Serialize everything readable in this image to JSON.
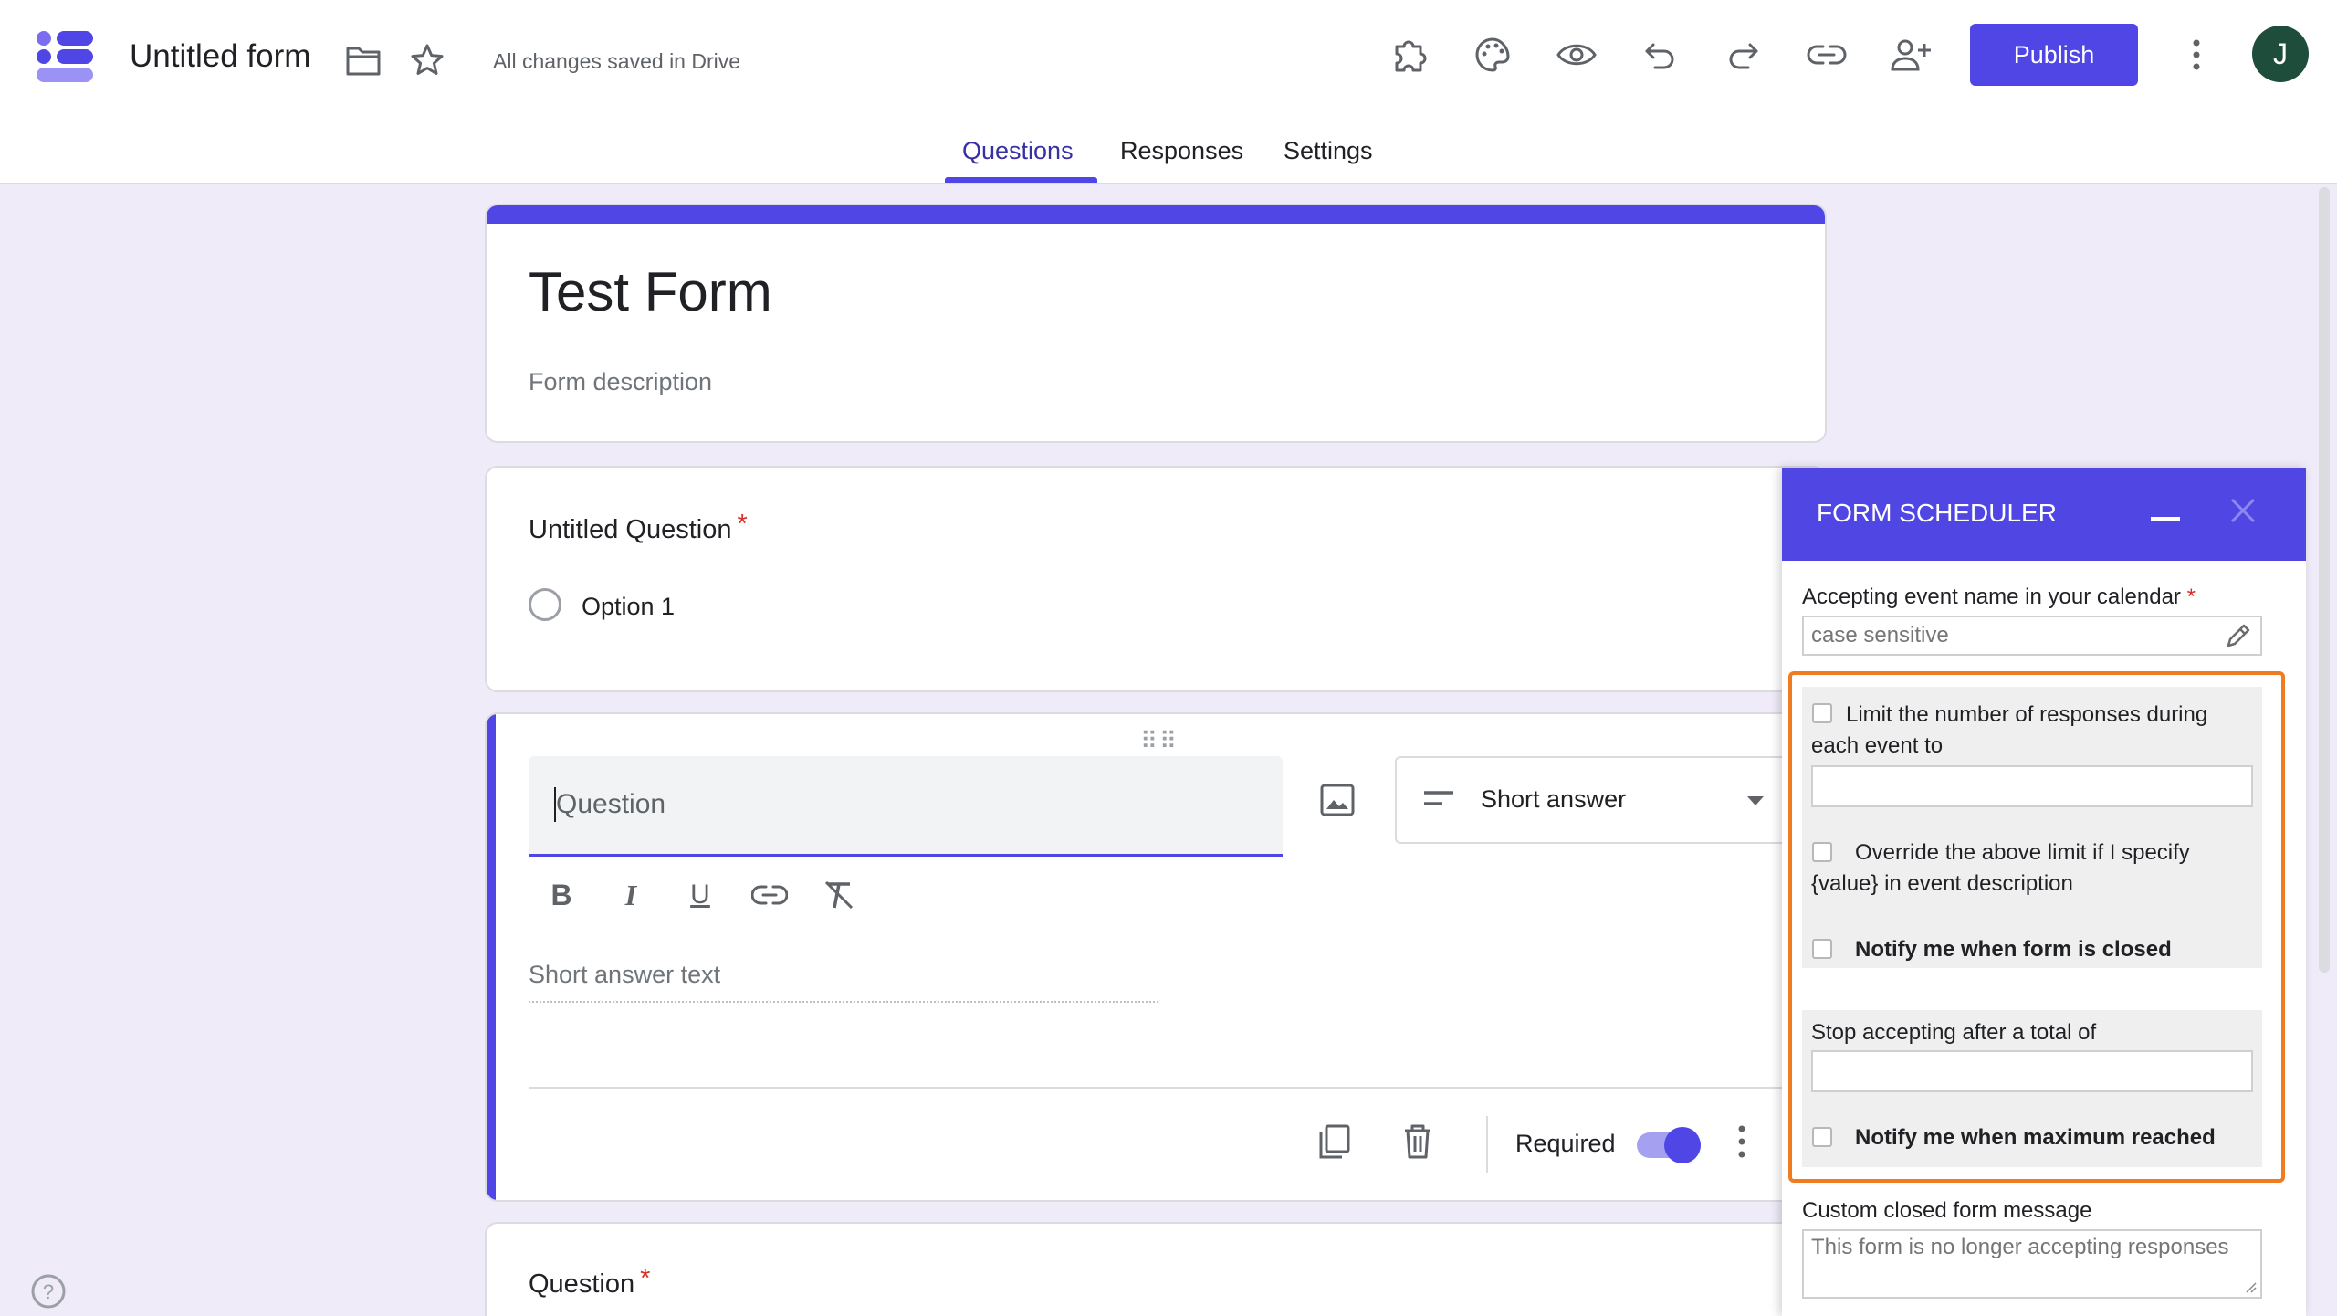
{
  "app": {
    "title": "Untitled form",
    "save_status": "All changes saved in Drive",
    "publish_label": "Publish",
    "avatar_initial": "J",
    "accent_color": "#4f46e5"
  },
  "tabs": [
    {
      "label": "Questions",
      "active": true
    },
    {
      "label": "Responses",
      "active": false
    },
    {
      "label": "Settings",
      "active": false
    }
  ],
  "toolbar_icons": [
    "folder-icon",
    "star-icon",
    "addon-puzzle-icon",
    "palette-icon",
    "preview-eye-icon",
    "undo-icon",
    "redo-icon",
    "link-icon",
    "add-collaborator-icon",
    "more-vert-icon"
  ],
  "form": {
    "title": "Test Form",
    "description_placeholder": "Form description"
  },
  "question1": {
    "title": "Untitled Question",
    "required_marker": "*",
    "option_label": "Option 1"
  },
  "question2": {
    "placeholder": "Question",
    "type_label": "Short answer",
    "answer_placeholder": "Short answer text",
    "required_label": "Required",
    "required_on": true
  },
  "question3": {
    "title": "Question",
    "required_marker": "*"
  },
  "scheduler": {
    "title": "FORM SCHEDULER",
    "event_name_label": "Accepting event name in your calendar",
    "required_marker": "*",
    "event_name_placeholder": "case sensitive",
    "limit_label": "Limit the number of responses during each event to",
    "override_label": "Override the above limit if I specify {value} in event description",
    "notify_closed_label": "Notify me when form is closed",
    "stop_total_label": "Stop accepting after a total of",
    "notify_max_label": "Notify me when maximum reached",
    "custom_message_label": "Custom closed form message",
    "custom_message_placeholder": "This form is no longer accepting responses",
    "highlight_color": "#f07c21"
  }
}
